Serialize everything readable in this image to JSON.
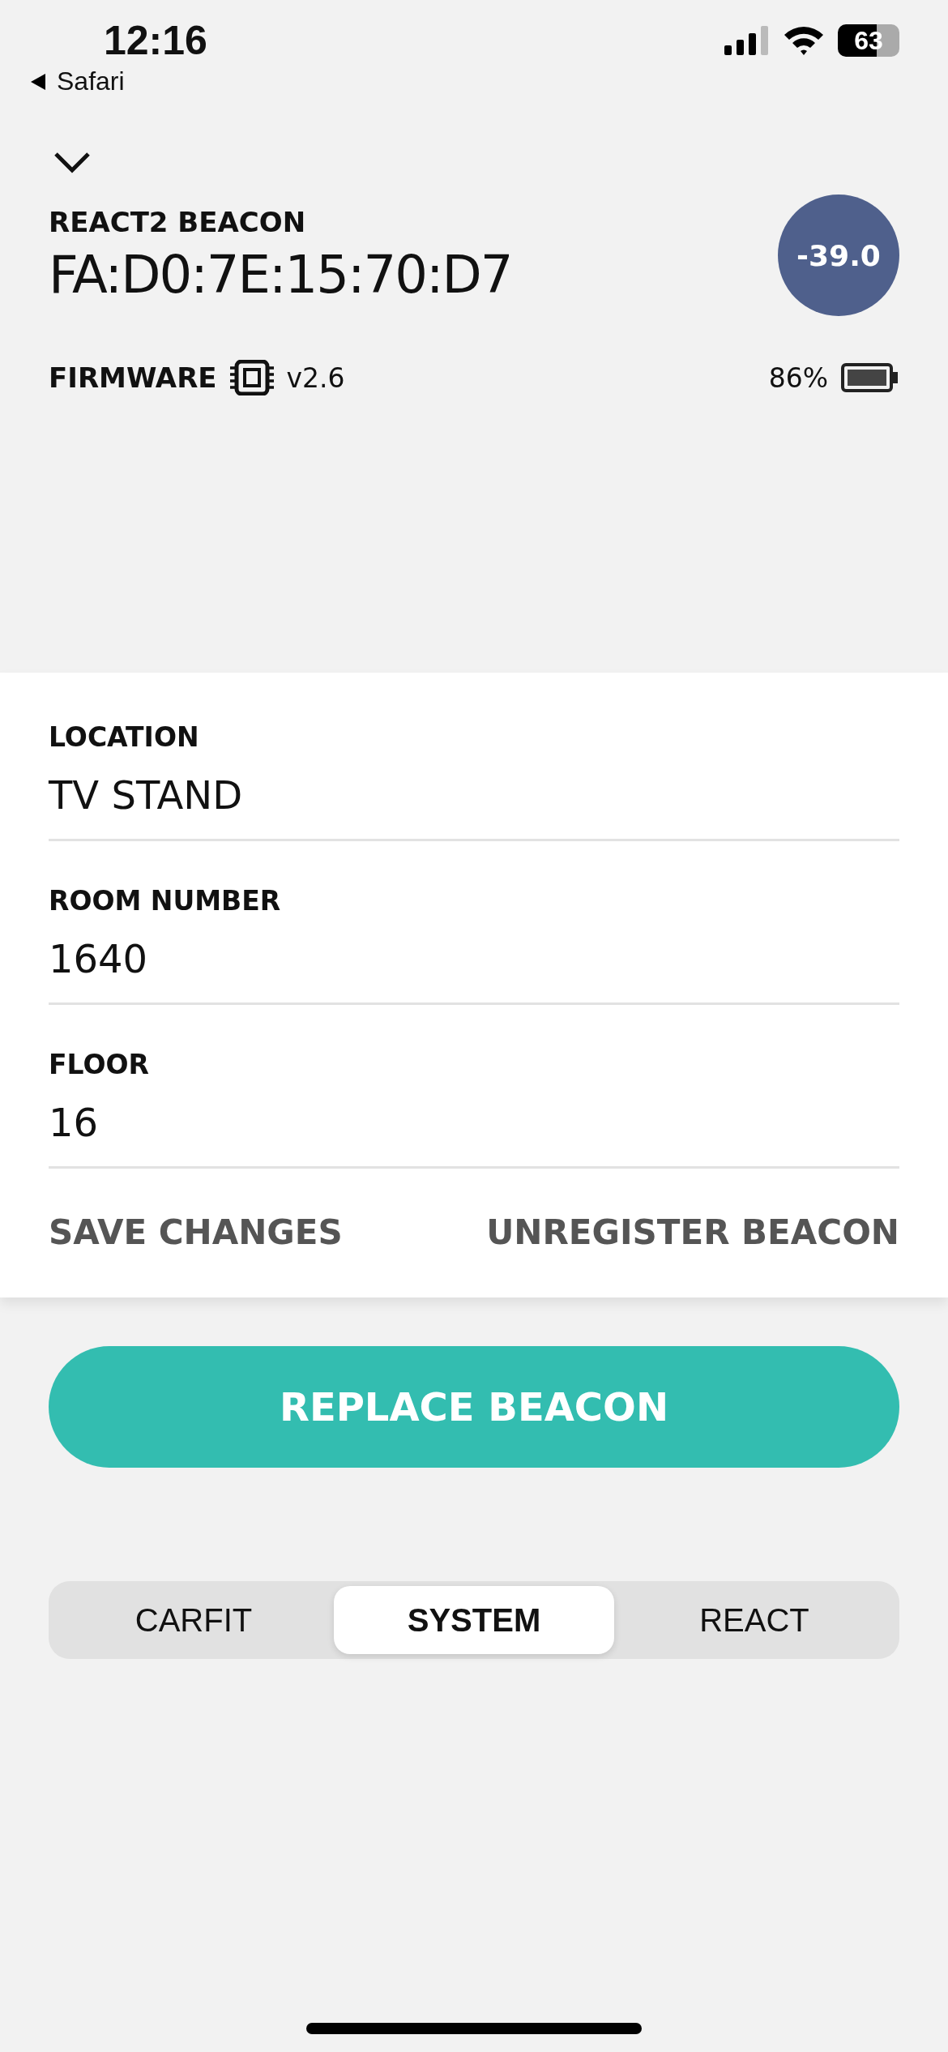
{
  "status_bar": {
    "time": "12:16",
    "back_label": "Safari",
    "battery": "63"
  },
  "beacon": {
    "type_label": "REACT2 BEACON",
    "address": "FA:D0:7E:15:70:D7",
    "signal": "-39.0",
    "firmware_label": "FIRMWARE",
    "firmware_version": "v2.6",
    "battery": "86%"
  },
  "fields": [
    {
      "label": "LOCATION",
      "value": "TV STAND"
    },
    {
      "label": "ROOM NUMBER",
      "value": "1640"
    },
    {
      "label": "FLOOR",
      "value": "16"
    }
  ],
  "actions": [
    "SAVE CHANGES",
    "UNREGISTER BEACON"
  ],
  "primary_button": "REPLACE BEACON",
  "tabs": [
    {
      "label": "CARFIT",
      "selected": false
    },
    {
      "label": "SYSTEM",
      "selected": true
    },
    {
      "label": "REACT",
      "selected": false
    }
  ]
}
